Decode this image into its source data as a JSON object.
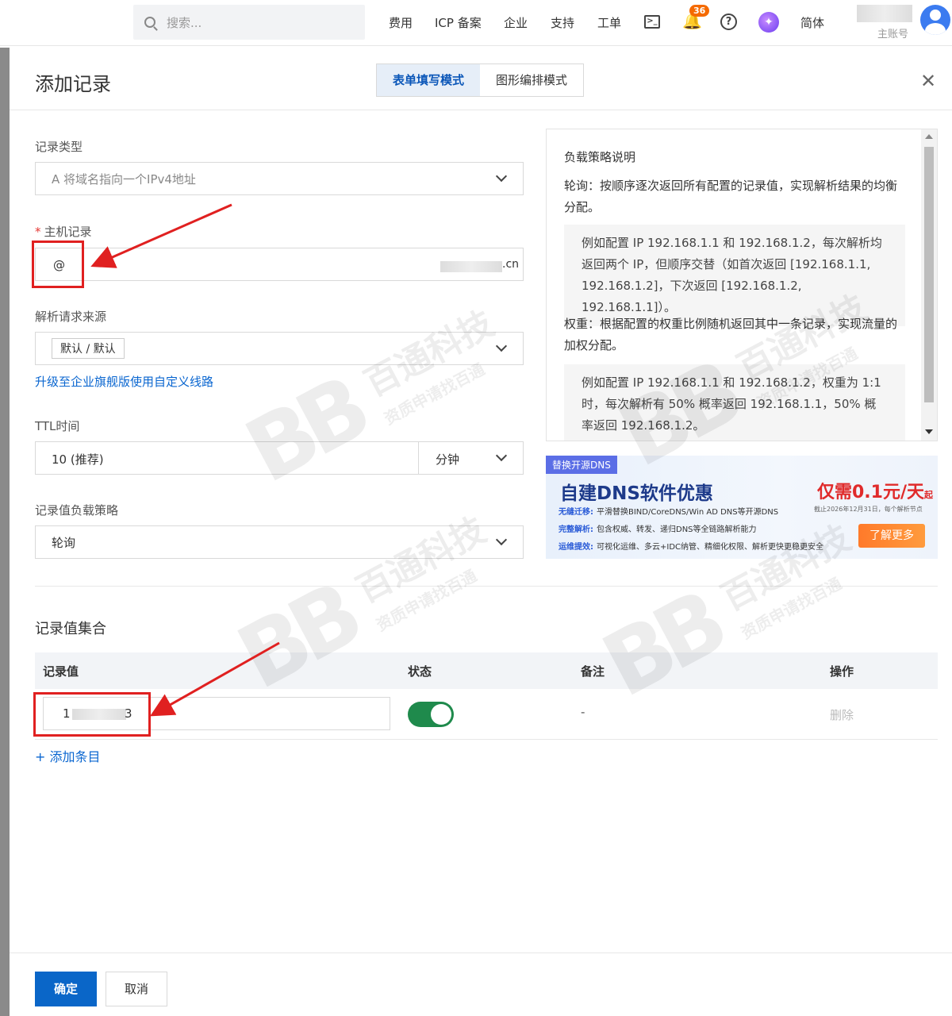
{
  "topnav": {
    "search_placeholder": "搜索...",
    "links": [
      "费用",
      "ICP 备案",
      "企业",
      "支持",
      "工单"
    ],
    "terminal_glyph": ">_",
    "bell_glyph": "🔔",
    "notification_count": "36",
    "help_glyph": "?",
    "ai_glyph": "✦",
    "language": "简体",
    "account_label": "主账号"
  },
  "drawer": {
    "title": "添加记录",
    "modes": [
      "表单填写模式",
      "图形编排模式"
    ],
    "close_glyph": "✕"
  },
  "form": {
    "record_type_label": "记录类型",
    "record_type_value": "A 将域名指向一个IPv4地址",
    "host_required_mark": "*",
    "host_label": "主机记录",
    "host_value": "@",
    "host_suffix": ".cn",
    "source_label": "解析请求来源",
    "source_value": "默认 / 默认",
    "upgrade_link": "升级至企业旗舰版使用自定义线路",
    "ttl_label": "TTL时间",
    "ttl_value": "10 (推荐)",
    "ttl_unit": "分钟",
    "lb_label": "记录值负载策略",
    "lb_value": "轮询"
  },
  "explanation": {
    "title": "负载策略说明",
    "roundrobin_text": "轮询：按顺序逐次返回所有配置的记录值，实现解析结果的均衡分配。",
    "roundrobin_example": "例如配置 IP 192.168.1.1 和 192.168.1.2，每次解析均返回两个 IP，但顺序交替（如首次返回 [192.168.1.1, 192.168.1.2]，下次返回 [192.168.1.2, 192.168.1.1]）。",
    "weight_text": "权重：根据配置的权重比例随机返回其中一条记录，实现流量的加权分配。",
    "weight_example": "例如配置 IP 192.168.1.1 和 192.168.1.2，权重为 1:1 时，每次解析有 50% 概率返回 192.168.1.1，50% 概率返回 192.168.1.2。"
  },
  "banner": {
    "tag": "替换开源DNS",
    "title": "自建DNS软件优惠",
    "price": "仅需0.1元/天",
    "price_suffix": "起",
    "note": "截止2026年12月31日，每个解析节点",
    "lines": [
      {
        "key": "无缝迁移:",
        "text": "平滑替换BIND/CoreDNS/Win AD DNS等开源DNS"
      },
      {
        "key": "完整解析:",
        "text": "包含权威、转发、递归DNS等全链路解析能力"
      },
      {
        "key": "运维提效:",
        "text": "可视化运维、多云+IDC纳管、精细化权限、解析更快更稳更安全"
      }
    ],
    "button": "了解更多"
  },
  "records": {
    "section_title": "记录值集合",
    "columns": [
      "记录值",
      "状态",
      "备注",
      "操作"
    ],
    "rows": [
      {
        "value_start": "1",
        "value_end": "3",
        "enabled": true,
        "remark": "-",
        "action": "删除"
      }
    ],
    "add_label": "+ 添加条目"
  },
  "footer": {
    "ok": "确定",
    "cancel": "取消"
  },
  "watermark": {
    "logo": "BB",
    "line1": "百通科技",
    "line2": "资质申请找百通"
  },
  "colors": {
    "primary": "#0a66c8",
    "link": "#0a66d0",
    "toggle_on": "#1f8a4c",
    "annotation_red": "#e02020"
  }
}
